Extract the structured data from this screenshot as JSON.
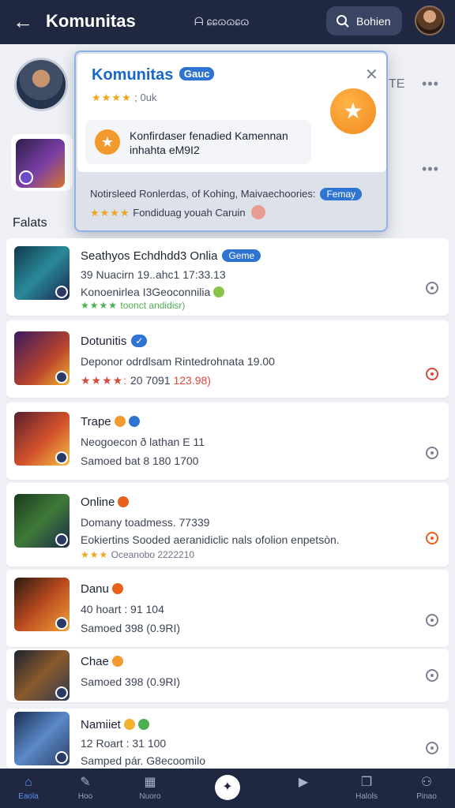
{
  "header": {
    "title": "Komunitas",
    "subtag": "ᗩ ɕɕɷɷɕɷ",
    "search_label": "Bohien"
  },
  "background": {
    "tail_text": "TE",
    "section_title": "Falats"
  },
  "popup": {
    "title": "Komunitas",
    "title_pill": "Gauc",
    "rating_stars": "★★★★",
    "rating_text": "; 0uk",
    "card_line1": "Konfirdaser fenadied Kamennan",
    "card_line2": "inhahta eM9I2",
    "foot_line1": "Notirsleed Ronlerdas, of Kohing, Maivaechoories:",
    "foot_tag": "Femay",
    "foot_line2_stars": "★★★★",
    "foot_line2": "Fondiduag youah Caruin"
  },
  "list": [
    {
      "name": "Seathyos Echdhdd3 Onlia",
      "badge": "Geme",
      "line2": "39 Nuacirn 19..ahc1 17:33.13",
      "line3": "Konoenirlea I3Geoconnilia",
      "line4_stars": "★★★★",
      "line4": "toonct andidisr)",
      "icon": "neutral"
    },
    {
      "name": "Dotunitis",
      "badge": "",
      "line2": "Deponor odrdlsam Rintedrohnata 19.00",
      "line3_stars": "★★★★:",
      "line3": "20 7091",
      "line3_extra": "123.98)",
      "icon": "red"
    },
    {
      "name": "Trape",
      "line2": "Neogoecon ð lathan E 11",
      "line3": "Samoed bat 8 180 1700",
      "icon": "neutral"
    },
    {
      "name": "Online",
      "line2": "Domany toadmess. 77339",
      "line3": "Eokiertins Sooded aeranidiclic nals ofolion enpetsòn.",
      "line4_stars": "★★★",
      "line4": "Oceanobo 2222210",
      "icon": "orange"
    },
    {
      "name": "Danu",
      "line2": "40 hoart : 91 104",
      "line3": "Samoed 398 (0.9RI)",
      "icon": "neutral"
    },
    {
      "name": "Chae",
      "line2": "Samoed 398 (0.9RI)",
      "icon": "neutral"
    },
    {
      "name": "Namiiet",
      "line2": "12 Roart : 31 100",
      "line3": "Samped pár. G8ecoomilo",
      "icon": "neutral"
    }
  ],
  "bottom_nav": [
    {
      "label": "Eaola",
      "icon": "home-icon",
      "active": true
    },
    {
      "label": "Hoo",
      "icon": "chat-icon"
    },
    {
      "label": "Nuoro",
      "icon": "calendar-icon"
    },
    {
      "label": "",
      "icon": "create-icon"
    },
    {
      "label": "",
      "icon": "play-icon"
    },
    {
      "label": "Halols",
      "icon": "book-icon"
    },
    {
      "label": "Pinao",
      "icon": "profile-icon"
    }
  ],
  "colors": {
    "header_bg": "#1f2741",
    "accent": "#2f74d0",
    "star": "#f0a51c"
  }
}
